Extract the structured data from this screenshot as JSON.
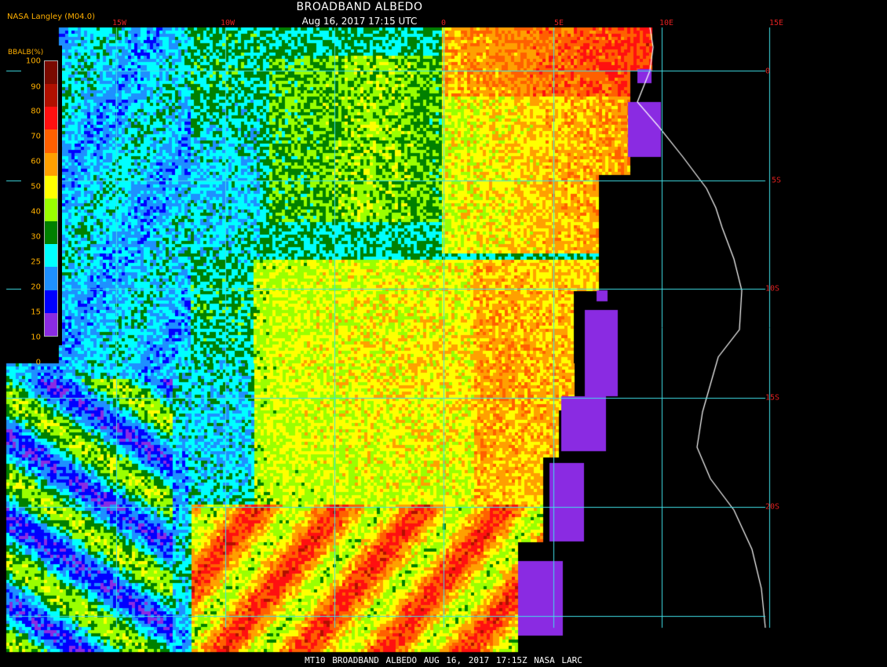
{
  "map": {
    "title": "BROADBAND ALBEDO",
    "timestamp": "Aug 16, 2017 17:15 UTC",
    "credit": "NASA Langley (M04.0)",
    "footer": "MT10  BROADBAND ALBEDO   AUG 16, 2017 17:15Z   NASA LARC",
    "longitude_labels": [
      "15W",
      "10W",
      "0",
      "5E",
      "10E",
      "15E"
    ],
    "latitude_labels": [
      "0",
      "5S",
      "10S",
      "15S",
      "20S"
    ],
    "colors": {
      "gridline": "#40e0e8",
      "coastline": "#ffffff",
      "labels": "#e02020",
      "legend_text": "#ffb000"
    }
  },
  "legend": {
    "title": "BBALB(%)",
    "ticks": [
      "100",
      "90",
      "80",
      "70",
      "60",
      "50",
      "40",
      "30",
      "25",
      "20",
      "15",
      "10",
      "0"
    ],
    "colors": [
      "#7a0a00",
      "#b01000",
      "#ff1010",
      "#ff6000",
      "#ffa000",
      "#ffff00",
      "#9aff00",
      "#008000",
      "#00ffff",
      "#1e90ff",
      "#0000ff",
      "#8a2be2"
    ]
  }
}
